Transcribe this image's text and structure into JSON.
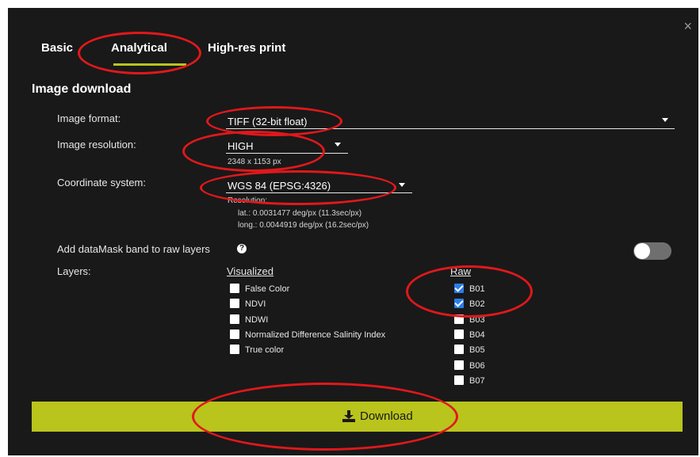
{
  "dialog": {
    "close_glyph": "×"
  },
  "tabs": [
    {
      "label": "Basic",
      "active": false
    },
    {
      "label": "Analytical",
      "active": true
    },
    {
      "label": "High-res print",
      "active": false
    }
  ],
  "accent_color": "#b9c41c",
  "highlight_color": "#e0181b",
  "section": {
    "title": "Image download"
  },
  "image_format": {
    "label": "Image format:",
    "value": "TIFF (32-bit float)"
  },
  "image_resolution": {
    "label": "Image resolution:",
    "value": "HIGH",
    "size": "2348 x 1153 px"
  },
  "coordinate_system": {
    "label": "Coordinate system:",
    "value": "WGS 84 (EPSG:4326)",
    "resolution_label": "Resolution:",
    "lat": "lat.: 0.0031477 deg/px (11.3sec/px)",
    "long": "long.: 0.0044919 deg/px (16.2sec/px)"
  },
  "datamask": {
    "label": "Add dataMask band to raw layers",
    "help_glyph": "?",
    "enabled": false
  },
  "layers": {
    "label": "Layers:",
    "visualized_heading": "Visualized",
    "raw_heading": "Raw",
    "visualized": [
      {
        "label": "False Color",
        "checked": false
      },
      {
        "label": "NDVI",
        "checked": false
      },
      {
        "label": "NDWI",
        "checked": false
      },
      {
        "label": "Normalized Difference Salinity Index",
        "checked": false
      },
      {
        "label": "True color",
        "checked": false
      }
    ],
    "raw": [
      {
        "label": "B01",
        "checked": true
      },
      {
        "label": "B02",
        "checked": true
      },
      {
        "label": "B03",
        "checked": false
      },
      {
        "label": "B04",
        "checked": false
      },
      {
        "label": "B05",
        "checked": false
      },
      {
        "label": "B06",
        "checked": false
      },
      {
        "label": "B07",
        "checked": false
      }
    ]
  },
  "download": {
    "label": "Download",
    "icon": "download-icon"
  }
}
